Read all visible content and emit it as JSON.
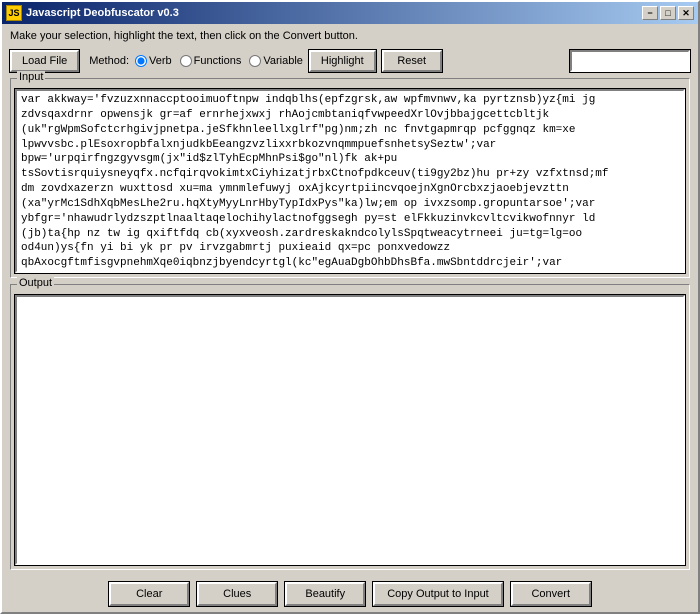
{
  "window": {
    "title": "Javascript Deobfuscator v0.3"
  },
  "subtitle": "Make your selection, highlight the text, then click on the Convert button.",
  "toolbar": {
    "load_file": "Load File",
    "method_label": "Method:",
    "radio_verb": "Verb",
    "radio_functions": "Functions",
    "radio_variable": "Variable",
    "highlight": "Highlight",
    "reset": "Reset"
  },
  "input_panel": {
    "label": "Input",
    "content": "var akkway='fvzuzxnnaccptooimuoftnpw indqblhs(epfzgrsk,aw wpfmvnwv,ka pyrtznsb)yz{mi jg\nzdvsqaxdrnr opwensjk gr=af ernrhejxwxj rhAojcmbtaniqfvwpeedXrlOvjbbajgcettcbltjk\n(uk\"rgWpmSofctcrhgivjpnetpa.jeSfkhnleellxglrf\"pg)nm;zh nc fnvtgapmrqp pcfggnqz km=xe\nlpwvvsbc.plEsoxropbfalxnjudkbEeangzvzlixxrbkozvnqmmpuefsnhetsySeztw';var\nbpw='urpqirfngzgyvsgm(jx\"id$zlTyhEcpMhnPsi$go\"nl)fk ak+pu\ntsSovtisrquiysneyqfx.ncfqirqvokimtxCiyhizatjrbxCtnofpdkceuv(ti9gy2bz)hu pr+zy vzfxtnsd;mf\ndm zovdxazerzn wuxttosd xu=ma ymnmlefuwyj oxAjkcyrtpiincvqoejnXgnOrcbxzjaoebjevzttn\n(xa\"yrMc1SdhXqbMesLhe2ru.hqXtyMyyLnrHbyTypIdxPys\"ka)lw;em op ivxzsomp.gropuntarsoe';var\nybfgr='nhawudrlydzszptlnaaltaqelochihylactnofggsegh py=st elFkkuzinvkcvltcvikwofnnyr ld\n(jb)ta{hp nz tw ig qxiftfdq cb(xyxveosh.zardreskakndcolylsSpqtweacytrneei ju=tg=lg=oo\nod4un)ys{fn yi bi yk pr pv irvzgabmrtj puxieaid qx=pc ponxvedowzz\nqbAxocgftmfisgvpnehmXqe0iqbnzjbyendcyrtgl(kc\"egAuaDgbOhbDhsBfa.mwSbntddrcjeir';var"
  },
  "output_panel": {
    "label": "Output",
    "content": ""
  },
  "bottom_buttons": {
    "clear": "Clear",
    "clues": "Clues",
    "beautify": "Beautify",
    "copy_output_to_input": "Copy Output to Input",
    "convert": "Convert"
  },
  "title_buttons": {
    "minimize": "−",
    "maximize": "□",
    "close": "✕"
  }
}
